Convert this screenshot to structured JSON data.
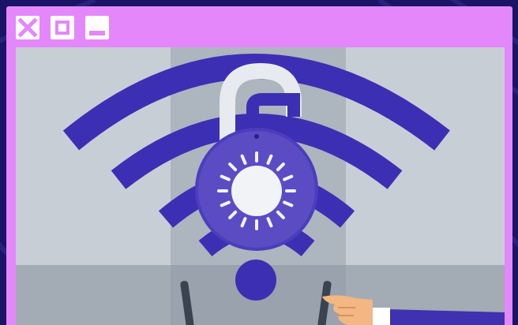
{
  "window": {
    "controls": {
      "close_icon": "close-icon",
      "maximize_icon": "maximize-icon",
      "minimize_icon": "minimize-icon"
    }
  },
  "illustration": {
    "icons": [
      "wifi-icon",
      "padlock-icon",
      "dial-icon",
      "pointing-hand-icon"
    ]
  },
  "colors": {
    "page_background": "#1a1466",
    "window_frame": "#e387fb",
    "control_white": "#ffffff",
    "sky_panel": "#c8ced6",
    "mid_panel": "#adb5bf",
    "floor": "#99a2ad",
    "wifi_purple": "#3d2fb3",
    "lock_purple": "#5b4cc4",
    "dial_face": "#f2f3f7",
    "shackle": "#e7ebef",
    "skin": "#f2b783",
    "sleeve": "#3f31b0",
    "cuff": "#ffffff"
  }
}
